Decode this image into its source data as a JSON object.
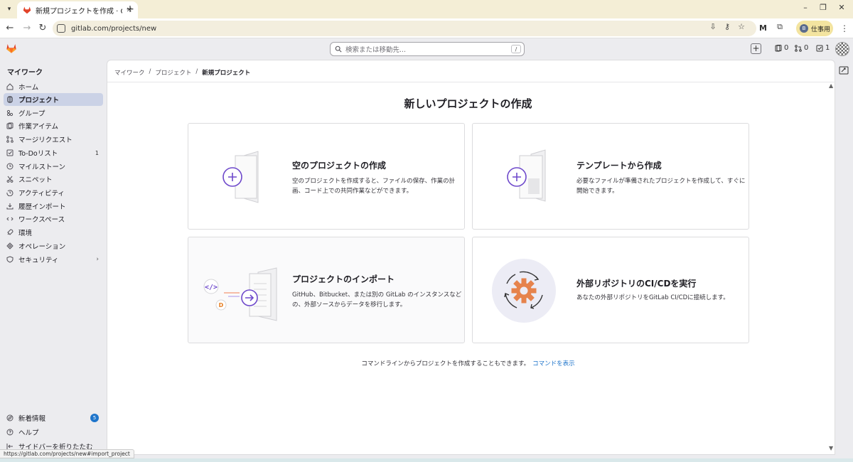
{
  "browser": {
    "tab_title": "新規プロジェクトを作成 · GitLab",
    "url": "gitlab.com/projects/new",
    "profile_initial": "B",
    "profile_label": "仕事用",
    "status_url": "https://gitlab.com/projects/new#import_project"
  },
  "topbar": {
    "search_placeholder": "検索または移動先...",
    "search_shortcut": "/",
    "issues_count": "0",
    "mr_count": "0",
    "todo_count": "1"
  },
  "sidebar": {
    "title": "マイワーク",
    "items": [
      {
        "label": "ホーム"
      },
      {
        "label": "プロジェクト"
      },
      {
        "label": "グループ"
      },
      {
        "label": "作業アイテム"
      },
      {
        "label": "マージリクエスト"
      },
      {
        "label": "To-Doリスト",
        "count": "1"
      },
      {
        "label": "マイルストーン"
      },
      {
        "label": "スニペット"
      },
      {
        "label": "アクティビティ"
      },
      {
        "label": "履歴インポート"
      },
      {
        "label": "ワークスペース"
      },
      {
        "label": "環境"
      },
      {
        "label": "オペレーション"
      },
      {
        "label": "セキュリティ"
      }
    ],
    "bottom": [
      {
        "label": "新着情報",
        "badge": "5"
      },
      {
        "label": "ヘルプ"
      },
      {
        "label": "サイドバーを折りたたむ"
      }
    ]
  },
  "breadcrumb": [
    "マイワーク",
    "プロジェクト",
    "新規プロジェクト"
  ],
  "page_title": "新しいプロジェクトの作成",
  "cards": [
    {
      "title": "空のプロジェクトの作成",
      "desc": "空のプロジェクトを作成すると、ファイルの保存、作業の計画、コード上での共同作業などができます。"
    },
    {
      "title": "テンプレートから作成",
      "desc": "必要なファイルが準備されたプロジェクトを作成して、すぐに開始できます。"
    },
    {
      "title": "プロジェクトのインポート",
      "desc": "GitHub、Bitbucket、または別の GitLab のインスタンスなどの、外部ソースからデータを移行します。"
    },
    {
      "title": "外部リポジトリのCI/CDを実行",
      "desc": "あなたの外部リポジトリをGitLab CI/CDに接続します。"
    }
  ],
  "footer": {
    "text": "コマンドラインからプロジェクトを作成することもできます。",
    "link": "コマンドを表示"
  },
  "colors": {
    "accent_purple": "#6e49cb",
    "link_blue": "#1f75cb",
    "gitlab_orange": "#e24329",
    "active_nav": "#cbd2e6"
  }
}
